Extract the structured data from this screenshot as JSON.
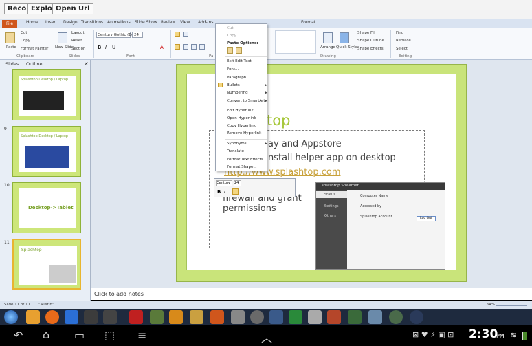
{
  "topbar": {
    "buttons": [
      "Record",
      "Explore",
      "Open Url"
    ]
  },
  "ribbon": {
    "file_tab": "File",
    "tabs": [
      "Home",
      "Insert",
      "Design",
      "Transitions",
      "Animations",
      "Slide Show",
      "Review",
      "View",
      "Add-Ins",
      "Format"
    ],
    "clipboard": {
      "paste": "Paste",
      "cut": "Cut",
      "copy": "Copy",
      "format_painter": "Format Painter",
      "group": "Clipboard"
    },
    "slides": {
      "new_slide": "New Slide",
      "layout": "Layout",
      "reset": "Reset",
      "section": "Section",
      "group": "Slides"
    },
    "font": {
      "font_name": "Century Gothic (Be",
      "font_size": "24",
      "group": "Font"
    },
    "paragraph_group": "Pa",
    "drawing": {
      "arrange": "Arrange",
      "quick_styles": "Quick Styles",
      "shape_fill": "Shape Fill",
      "shape_outline": "Shape Outline",
      "shape_effects": "Shape Effects",
      "group": "Drawing"
    },
    "editing": {
      "find": "Find",
      "replace": "Replace",
      "select": "Select",
      "group": "Editing"
    }
  },
  "left_panel": {
    "tabs": [
      "Slides",
      "Outline"
    ],
    "thumbnails": [
      {
        "num": "",
        "title": "Splashtop Desktop / Laptop"
      },
      {
        "num": "9",
        "title": "Splashtop Desktop / Laptop"
      },
      {
        "num": "10",
        "title": "Desktop->Tablet"
      },
      {
        "num": "11",
        "title": "Splashtop"
      }
    ]
  },
  "slide": {
    "title_fragment": "top",
    "lines": [
      "ay and Appstore",
      "nstall helper app on desktop",
      "http://www.splashtop.com",
      "firewall and grant",
      "permissions"
    ],
    "font_box": "Century",
    "font_size": "24"
  },
  "screenshot_window": {
    "title": "splashtop Streamer",
    "nav": [
      "Status",
      "Settings",
      "Others"
    ],
    "computer_name_label": "Computer Name",
    "accessed_by": "Accessed by",
    "account_label": "Splashtop Account",
    "logout": "Log Out"
  },
  "context_menu": {
    "items": [
      "Cut",
      "Copy",
      "Paste Options:",
      "Exit Edit Text",
      "Font...",
      "Paragraph...",
      "Bullets",
      "Numbering",
      "Convert to SmartArt",
      "Edit Hyperlink...",
      "Open Hyperlink",
      "Copy Hyperlink",
      "Remove Hyperlink",
      "Synonyms",
      "Translate",
      "Format Text Effects...",
      "Format Shape..."
    ]
  },
  "notes": {
    "placeholder": "Click to add notes"
  },
  "status": {
    "slide_info": "Slide 11 of 11",
    "theme": "\"Austin\"",
    "zoom": "64%"
  },
  "clock": {
    "time": "2:30",
    "ampm": "PM"
  },
  "icons": [
    "record-icon",
    "paste-icon",
    "android-back-icon",
    "android-home-icon",
    "android-recents-icon",
    "android-menu-icon",
    "wifi-icon",
    "battery-icon"
  ]
}
